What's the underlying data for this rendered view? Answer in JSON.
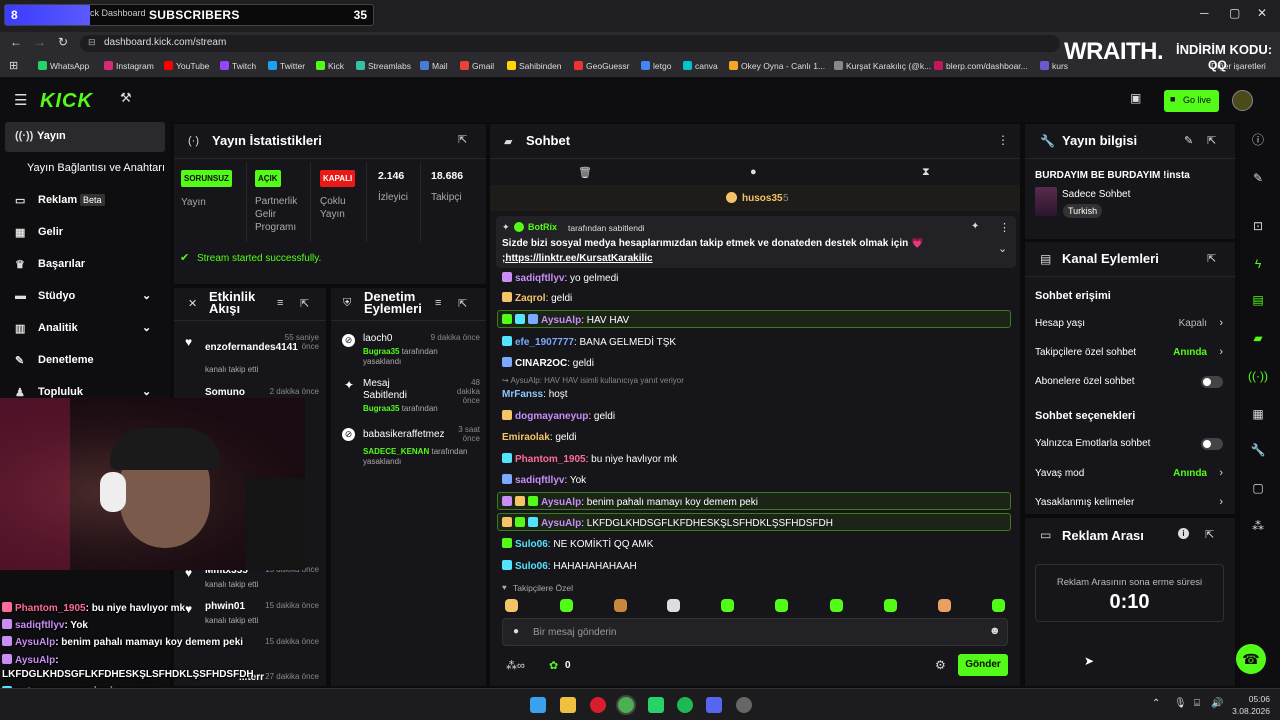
{
  "browser": {
    "tab_title": "ck Dashboard",
    "url": "dashboard.kick.com/stream",
    "bookmarks": [
      "WhatsApp",
      "Instagram",
      "YouTube",
      "Twitch",
      "Twitter",
      "Kick",
      "Streamlabs",
      "Mail",
      "Gmail",
      "Sahibinden",
      "GeoGuessr",
      "letgo",
      "canva",
      "Okey Oyna - Canlı 1...",
      "Kurşat Karakılıç (@k...",
      "blerp.com/dashboar...",
      "kurs"
    ],
    "bookmarks_more": "Diğer işaretleri"
  },
  "overlay": {
    "subs_count_left": "8",
    "subs_label": "SUBSCRIBERS",
    "subs_goal": "35",
    "subs_progress": 0.23,
    "brand": "WRAITH.",
    "promo_label": "İNDİRİM KODU:",
    "promo_code": "QQ",
    "chat_lines": [
      {
        "user": "Phantom_1905",
        "text": ": bu niye havlıyor mk"
      },
      {
        "user": "sadiqftllyv",
        "text": ": Yok"
      },
      {
        "user": "AysuAlp",
        "text": ": benim pahalı mamayı koy demem peki"
      },
      {
        "user": "AysuAlp",
        "text": ":"
      },
      {
        "user": "",
        "text": "LKFDGLKHDSGFLKFDHESKŞLSFHDKLŞSFHDSFDH"
      },
      {
        "user": "Sulo06",
        "text": ": NE KOMİKTİ QQ AMK"
      },
      {
        "user": "Sulo06",
        "text": ": HAHAHAHAHAAH"
      }
    ]
  },
  "topnav": {
    "logo": "KICK",
    "go_live": "Go live"
  },
  "sidebar": {
    "items": [
      {
        "label": "Yayın",
        "icon": "broadcast-icon"
      },
      {
        "label": "Yayın Bağlantısı ve Anahtarı",
        "icon": ""
      },
      {
        "label": "Reklam",
        "icon": "ad-icon",
        "badge": "Beta"
      },
      {
        "label": "Gelir",
        "icon": "revenue-icon"
      },
      {
        "label": "Başarılar",
        "icon": "trophy-icon"
      },
      {
        "label": "Stüdyo",
        "icon": "studio-icon"
      },
      {
        "label": "Analitik",
        "icon": "analytics-icon"
      },
      {
        "label": "Denetleme",
        "icon": "moderation-icon"
      },
      {
        "label": "Topluluk",
        "icon": "community-icon"
      }
    ]
  },
  "stats": {
    "title": "Yayın İstatistikleri",
    "items": [
      {
        "badge": "SORUNSUZ",
        "label": "Yayın",
        "color": "#53fc18"
      },
      {
        "badge": "AÇIK",
        "label": "Partnerlik Gelir Programı",
        "color": "#53fc18"
      },
      {
        "badge": "KAPALI",
        "label": "Çoklu Yayın",
        "color": "#e91916"
      },
      {
        "value": "2.146",
        "label": "İzleyici"
      },
      {
        "value": "18.686",
        "label": "Takipçi"
      }
    ],
    "success": "Stream started successfully."
  },
  "activity": {
    "title": "Etkinlik Akışı",
    "rows": [
      {
        "name": "enzofernandes4141",
        "time": "55 saniye önce",
        "sub": "kanalı takip etti"
      },
      {
        "name": "Somuno",
        "time": "2 dakika önce",
        "sub": ""
      },
      {
        "name": "Mmtx355",
        "time": "15 dakika önce",
        "sub": "kanalı takip etti"
      },
      {
        "name": "phwin01",
        "time": "15 dakika önce",
        "sub": "kanalı takip etti"
      },
      {
        "name": "",
        "time": "15 dakika önce",
        "sub": ""
      },
      {
        "name": "...terr",
        "time": "27 dakika önce",
        "sub": ""
      }
    ]
  },
  "modlog": {
    "title": "Denetim Eylemleri",
    "rows": [
      {
        "name": "laoch0",
        "time": "9 dakika önce",
        "by": "Bugraa35",
        "sub": "tarafından yasaklandı"
      },
      {
        "name": "Mesaj Sabitlendi",
        "time": "48 dakika önce",
        "by": "Bugraa35",
        "sub": "tarafından"
      },
      {
        "name": "babasikeraffetmez",
        "time": "3 saat önce",
        "by": "SADECE_KENAN",
        "sub": "tarafından yasaklandı"
      }
    ]
  },
  "chat": {
    "title": "Sohbet",
    "gifter": "husos35",
    "gifter_count": "5",
    "pinned_by": "BotRix",
    "pinned_suffix": "tarafından sabitlendi",
    "pinned_text": "Sizde bizi sosyal medya hesaplarımızdan takip etmek ve donateden destek olmak için 💗",
    "pinned_link": ";https://linktr.ee/KursatKarakilic",
    "messages": [
      {
        "user": "sadiqftllyv",
        "text": "yo gelmedi",
        "color": "#c98ef5",
        "hl": false
      },
      {
        "user": "Zaqrol",
        "text": "geldi",
        "color": "#f5c469",
        "hl": false
      },
      {
        "user": "AysuAlp",
        "text": "HAV HAV",
        "color": "#c98ef5",
        "hl": true
      },
      {
        "user": "efe_1907777",
        "text": "BANA GELMEDİ TŞK",
        "color": "#7aa9ff",
        "hl": false
      },
      {
        "user": "CINAR2OC",
        "text": "geldi",
        "color": "#ffffff",
        "hl": false
      },
      {
        "user": "MrFanss",
        "text": "hoşt",
        "color": "#8ec6ff",
        "hl": false,
        "reply": "↪ AysuAlp: HAV HAV isimli kullanıcıya yanıt veriyor"
      },
      {
        "user": "dogmayaneyup",
        "text": "geldi",
        "color": "#c98ef5",
        "hl": false
      },
      {
        "user": "Emiraolak",
        "text": "geldi",
        "color": "#f5c469",
        "hl": false
      },
      {
        "user": "Phantom_1905",
        "text": "bu niye havlıyor mk",
        "color": "#ff6b9a",
        "hl": false
      },
      {
        "user": "sadiqftllyv",
        "text": "Yok",
        "color": "#c98ef5",
        "hl": false
      },
      {
        "user": "AysuAlp",
        "text": "benim pahalı mamayı koy demem peki",
        "color": "#c98ef5",
        "hl": true
      },
      {
        "user": "AysuAlp",
        "text": "LKFDGLKHDSGFLKFDHESKŞLSFHDKLŞSFHDSFDH",
        "color": "#c98ef5",
        "hl": true
      },
      {
        "user": "Sulo06",
        "text": "NE KOMİKTİ QQ AMK",
        "color": "#53e3ff",
        "hl": false
      },
      {
        "user": "Sulo06",
        "text": "HAHAHAHAHAAH",
        "color": "#53e3ff",
        "hl": false
      }
    ],
    "followers_only": "Takipçilere Özel",
    "input_placeholder": "Bir mesaj gönderin",
    "points": "0",
    "send": "Gönder"
  },
  "info": {
    "title": "Yayın bilgisi",
    "stream_title": "BURDAYIM BE BURDAYIM !insta",
    "category": "Sadece Sohbet",
    "tag": "Turkish"
  },
  "channel_actions": {
    "title": "Kanal Eylemleri",
    "access_title": "Sohbet erişimi",
    "access": [
      {
        "label": "Hesap yaşı",
        "value": "Kapalı",
        "kind": "arrow",
        "accent": false
      },
      {
        "label": "Takipçilere özel sohbet",
        "value": "Anında",
        "kind": "arrow",
        "accent": true
      },
      {
        "label": "Abonelere özel sohbet",
        "value": "",
        "kind": "toggle",
        "accent": false
      }
    ],
    "options_title": "Sohbet seçenekleri",
    "options": [
      {
        "label": "Yalnızca Emotlarla sohbet",
        "value": "",
        "kind": "toggle",
        "accent": false
      },
      {
        "label": "Yavaş mod",
        "value": "Anında",
        "kind": "arrow",
        "accent": true
      },
      {
        "label": "Yasaklanmış kelimeler",
        "value": "",
        "kind": "arrow",
        "accent": false
      }
    ]
  },
  "ad_break": {
    "title": "Reklam Arası",
    "label": "Reklam Arasının sona erme süresi",
    "time": "0:10"
  },
  "taskbar": {
    "time": "05:06",
    "date": "3.08.2026"
  }
}
